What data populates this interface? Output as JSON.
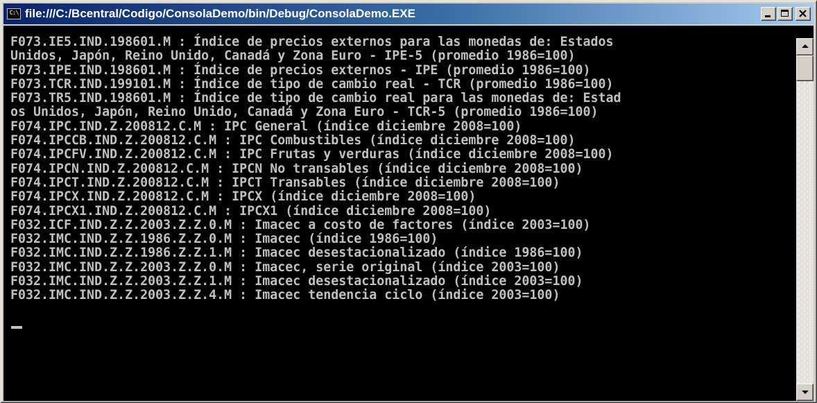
{
  "window": {
    "title": "file:///C:/Bcentral/Codigo/ConsolaDemo/bin/Debug/ConsolaDemo.EXE",
    "icon_label": "C:\\",
    "icon": "console-app-icon",
    "buttons": {
      "minimize": "minimize-icon",
      "maximize": "maximize-icon",
      "close": "close-icon"
    },
    "colors": {
      "titlebar_start": "#0a246a",
      "titlebar_end": "#a6caf0",
      "console_bg": "#000000",
      "console_text": "#c0c0c0"
    }
  },
  "console": {
    "lines": [
      "F073.IE5.IND.198601.M : Índice de precios externos para las monedas de: Estados",
      "Unidos, Japón, Reino Unido, Canadá y Zona Euro - IPE-5 (promedio 1986=100)",
      "F073.IPE.IND.198601.M : Índice de precios externos - IPE (promedio 1986=100)",
      "F073.TCR.IND.199101.M : Índice de tipo de cambio real - TCR (promedio 1986=100)",
      "F073.TR5.IND.198601.M : Índice de tipo de cambio real para las monedas de: Estad",
      "os Unidos, Japón, Reino Unido, Canadá y Zona Euro - TCR-5 (promedio 1986=100)",
      "F074.IPC.IND.Z.200812.C.M : IPC General (índice diciembre 2008=100)",
      "F074.IPCCB.IND.Z.200812.C.M : IPC Combustibles (índice diciembre 2008=100)",
      "F074.IPCFV.IND.Z.200812.C.M : IPC Frutas y verduras (índice diciembre 2008=100)",
      "F074.IPCN.IND.Z.200812.C.M : IPCN No transables (índice diciembre 2008=100)",
      "F074.IPCT.IND.Z.200812.C.M : IPCT Transables (índice diciembre 2008=100)",
      "F074.IPCX.IND.Z.200812.C.M : IPCX (índice diciembre 2008=100)",
      "F074.IPCX1.IND.Z.200812.C.M : IPCX1 (índice diciembre 2008=100)",
      "F032.ICF.IND.Z.Z.2003.Z.Z.0.M : Imacec a costo de factores (índice 2003=100)",
      "F032.IMC.IND.Z.Z.1986.Z.Z.0.M : Imacec (índice 1986=100)",
      "F032.IMC.IND.Z.Z.1986.Z.Z.1.M : Imacec desestacionalizado (índice 1986=100)",
      "F032.IMC.IND.Z.Z.2003.Z.Z.0.M : Imacec, serie original (índice 2003=100)",
      "F032.IMC.IND.Z.Z.2003.Z.Z.1.M : Imacec desestacionalizado (índice 2003=100)",
      "F032.IMC.IND.Z.Z.2003.Z.Z.4.M : Imacec tendencia ciclo (índice 2003=100)"
    ]
  },
  "scrollbar": {
    "up_icon": "arrow-up-icon",
    "down_icon": "arrow-down-icon"
  }
}
